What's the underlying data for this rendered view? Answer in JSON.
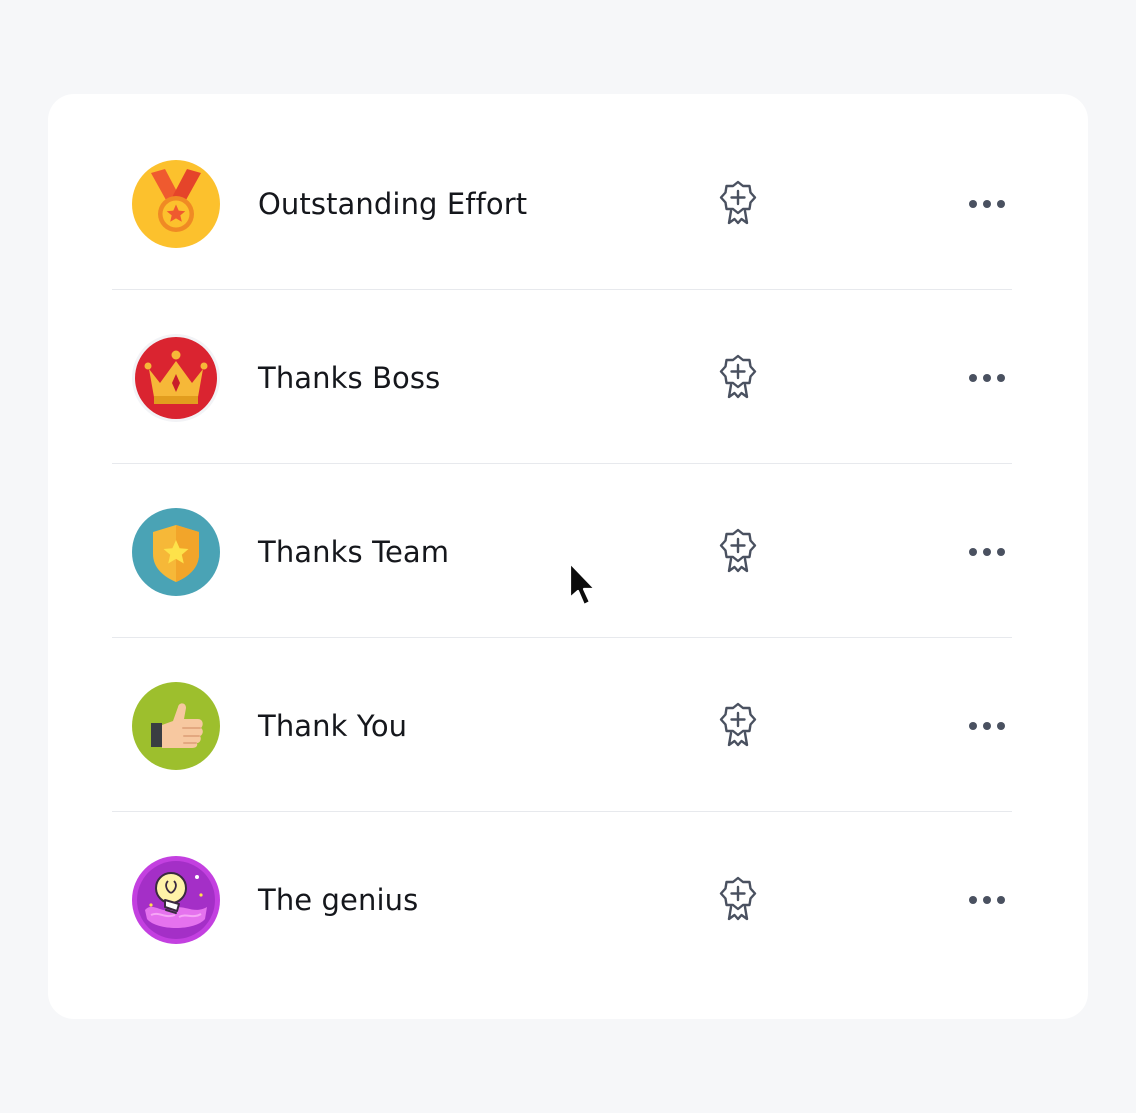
{
  "badges": [
    {
      "name": "Outstanding Effort",
      "icon": "medal-icon"
    },
    {
      "name": "Thanks Boss",
      "icon": "crown-icon"
    },
    {
      "name": "Thanks Team",
      "icon": "shield-star-icon"
    },
    {
      "name": "Thank You",
      "icon": "thumbs-up-icon"
    },
    {
      "name": "The genius",
      "icon": "lightbulb-brain-icon"
    }
  ],
  "actions": {
    "award_icon": "award-plus-icon",
    "more_icon": "more-horizontal-icon"
  },
  "colors": {
    "background": "#f6f7f9",
    "card": "#ffffff",
    "text": "#15171c",
    "icon_stroke": "#4a5160",
    "divider": "#e7e9ed"
  }
}
